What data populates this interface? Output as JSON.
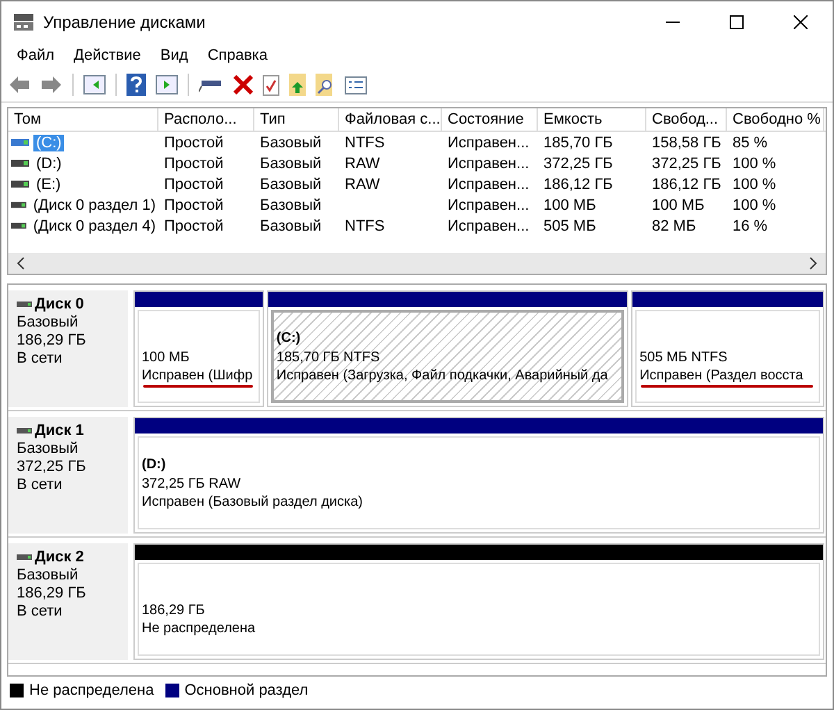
{
  "window": {
    "title": "Управление дисками"
  },
  "menu": [
    "Файл",
    "Действие",
    "Вид",
    "Справка"
  ],
  "table": {
    "columns": [
      "Том",
      "Располо...",
      "Тип",
      "Файловая с...",
      "Состояние",
      "Емкость",
      "Свобод...",
      "Свободно %"
    ],
    "rows": [
      {
        "selected": true,
        "cells": [
          "(C:)",
          "Простой",
          "Базовый",
          "NTFS",
          "Исправен...",
          "185,70 ГБ",
          "158,58 ГБ",
          "85 %"
        ]
      },
      {
        "selected": false,
        "cells": [
          "(D:)",
          "Простой",
          "Базовый",
          "RAW",
          "Исправен...",
          "372,25 ГБ",
          "372,25 ГБ",
          "100 %"
        ]
      },
      {
        "selected": false,
        "cells": [
          "(E:)",
          "Простой",
          "Базовый",
          "RAW",
          "Исправен...",
          "186,12 ГБ",
          "186,12 ГБ",
          "100 %"
        ]
      },
      {
        "selected": false,
        "cells": [
          "(Диск 0 раздел 1)",
          "Простой",
          "Базовый",
          "",
          "Исправен...",
          "100 МБ",
          "100 МБ",
          "100 %"
        ]
      },
      {
        "selected": false,
        "cells": [
          "(Диск 0 раздел 4)",
          "Простой",
          "Базовый",
          "NTFS",
          "Исправен...",
          "505 МБ",
          "82 МБ",
          "16 %"
        ]
      }
    ]
  },
  "disks": [
    {
      "name": "Диск 0",
      "type": "Базовый",
      "size": "186,29 ГБ",
      "status": "В сети",
      "partitions": [
        {
          "kind": "primary",
          "selected": false,
          "underlined": true,
          "size": "100 МБ",
          "status": "Исправен (Шифр"
        },
        {
          "kind": "primary",
          "selected": true,
          "underlined": false,
          "label": "(C:)",
          "size": "185,70 ГБ NTFS",
          "status": "Исправен (Загрузка, Файл подкачки, Аварийный да"
        },
        {
          "kind": "primary",
          "selected": false,
          "underlined": true,
          "size": "505 МБ NTFS",
          "status": "Исправен (Раздел восста"
        }
      ]
    },
    {
      "name": "Диск 1",
      "type": "Базовый",
      "size": "372,25 ГБ",
      "status": "В сети",
      "partitions": [
        {
          "kind": "primary",
          "selected": false,
          "underlined": false,
          "label": "(D:)",
          "size": "372,25 ГБ RAW",
          "status": "Исправен (Базовый раздел диска)"
        }
      ]
    },
    {
      "name": "Диск 2",
      "type": "Базовый",
      "size": "186,29 ГБ",
      "status": "В сети",
      "partitions": [
        {
          "kind": "unallocated",
          "selected": false,
          "underlined": false,
          "size": "186,29 ГБ",
          "status": "Не распределена"
        }
      ]
    }
  ],
  "legend": [
    {
      "kind": "unallocated",
      "label": "Не распределена"
    },
    {
      "kind": "primary",
      "label": "Основной раздел"
    }
  ]
}
